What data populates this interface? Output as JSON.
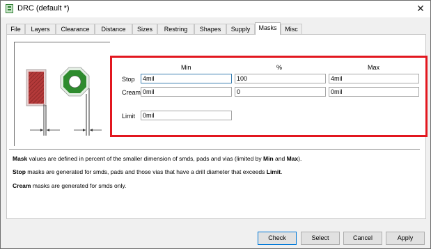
{
  "window": {
    "title": "DRC (default *)"
  },
  "tabs": [
    "File",
    "Layers",
    "Clearance",
    "Distance",
    "Sizes",
    "Restring",
    "Shapes",
    "Supply",
    "Masks",
    "Misc"
  ],
  "active_tab": "Masks",
  "masks": {
    "col_min": "Min",
    "col_percent": "%",
    "col_max": "Max",
    "stop_label": "Stop",
    "cream_label": "Cream",
    "limit_label": "Limit",
    "stop_min": "4mil",
    "stop_percent": "100",
    "stop_max": "4mil",
    "cream_min": "0mil",
    "cream_percent": "0",
    "cream_max": "0mil",
    "limit": "0mil"
  },
  "description": {
    "line1_bold": "Mask",
    "line1_text": " values are defined in percent of the smaller dimension of smds, pads and vias (limited by ",
    "line1_min": "Min",
    "line1_and": " and ",
    "line1_max": "Max",
    "line1_end": ").",
    "line2_bold": "Stop",
    "line2_text": " masks are generated for smds, pads and those vias that have a drill diameter that exceeds ",
    "line2_limit": "Limit",
    "line2_end": ".",
    "line3_bold": "Cream",
    "line3_text": " masks are generated for smds only."
  },
  "buttons": {
    "check": "Check",
    "select": "Select",
    "cancel": "Cancel",
    "apply": "Apply"
  },
  "colors": {
    "highlight": "#e2171f",
    "smd_fill": "#b43a3a",
    "pad_fill": "#2e8b2e"
  }
}
